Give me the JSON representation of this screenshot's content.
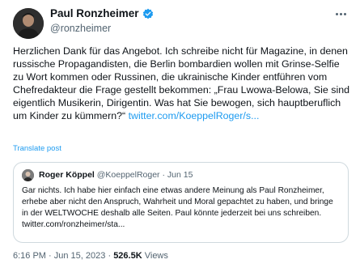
{
  "author": {
    "name": "Paul Ronzheimer",
    "handle": "@ronzheimer"
  },
  "post": {
    "text": "Herzlichen Dank für das Angebot. Ich schreibe nicht für Magazine, in denen russische Propagandisten, die Berlin bombardien wollen mit Grinse-Selfie zu Wort kommen oder Russinen, die ukrainische Kinder entführen vom Chefredakteur die Frage gestellt bekommen: „Frau Lwowa-Belowa, Sie sind eigentlich Musikerin, Dirigentin. Was hat Sie bewogen, sich hauptberuflich um Kinder zu kümmern?“",
    "link": "twitter.com/KoeppelRoger/s...",
    "translate_label": "Translate post"
  },
  "quote": {
    "name": "Roger Köppel",
    "handle": "@KoeppelRoger",
    "separator": "·",
    "date": "Jun 15",
    "text": "Gar nichts. Ich habe hier einfach eine etwas andere Meinung als Paul Ronzheimer, erhebe aber nicht den Anspruch, Wahrheit und Moral gepachtet zu haben, und bringe in der WELTWOCHE deshalb alle Seiten. Paul könnte jederzeit bei uns schreiben. twitter.com/ronzheimer/sta..."
  },
  "meta": {
    "time": "6:16 PM",
    "separator": "·",
    "date": "Jun 15, 2023",
    "views": "526.5K",
    "views_label": "Views"
  },
  "colors": {
    "link": "#1d9bf0",
    "secondary_text": "#536471",
    "border": "#cfd9de",
    "verified": "#1d9bf0"
  },
  "icons": [
    "verified-badge-icon",
    "more-options-icon"
  ]
}
